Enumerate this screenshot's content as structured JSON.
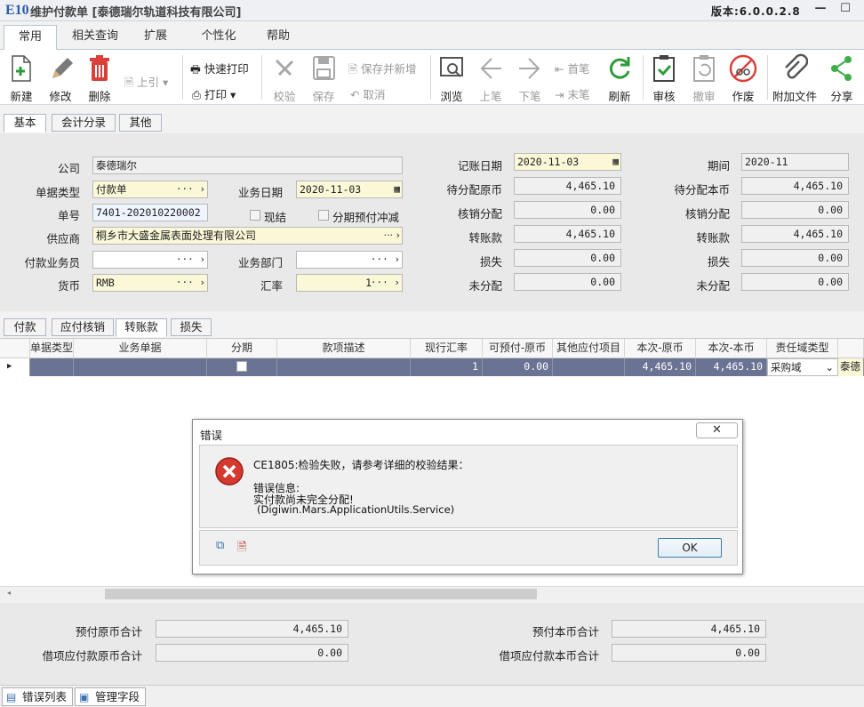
{
  "app": {
    "logo": "E10",
    "title": "维护付款单",
    "company": "[泰德瑞尔轨道科技有限公司]",
    "version": "版本:6.0.0.2.8",
    "minimize_glyph": "—",
    "maximize_glyph": "☐"
  },
  "menu_tabs": [
    "常用",
    "相关查询",
    "扩展",
    "个性化",
    "帮助"
  ],
  "toolbar": {
    "new": "新建",
    "edit": "修改",
    "delete": "删除",
    "upref": "上引",
    "quick_print": "快速打印",
    "print": "打印",
    "check": "校验",
    "save": "保存",
    "save_new": "保存并新增",
    "cancel": "取消",
    "browse": "浏览",
    "prev": "上笔",
    "next": "下笔",
    "first": "首笔",
    "last": "末笔",
    "refresh": "刷新",
    "approve": "审核",
    "unapprove": "撤审",
    "void": "作废",
    "attach": "附加文件",
    "share": "分享"
  },
  "main_tabs": [
    "基本",
    "会计分录",
    "其他"
  ],
  "form": {
    "company_label": "公司",
    "company_value": "泰德瑞尔",
    "doc_type_label": "单据类型",
    "doc_type_value": "付款单",
    "biz_date_label": "业务日期",
    "biz_date_value": "2020-11-03",
    "doc_no_label": "单号",
    "doc_no_value": "7401-202010220002",
    "cash_label": "现结",
    "installment_offset_label": "分期预付冲减",
    "supplier_label": "供应商",
    "supplier_value": "桐乡市大盛金属表面处理有限公司",
    "payer_label": "付款业务员",
    "dept_label": "业务部门",
    "currency_label": "货币",
    "currency_value": "RMB",
    "rate_label": "汇率",
    "rate_value": "1",
    "posting_date_label": "记账日期",
    "posting_date_value": "2020-11-03",
    "period_label": "期间",
    "period_value": "2020-11",
    "pending_orig_label": "待分配原币",
    "pending_orig_value": "4,465.10",
    "pending_local_label": "待分配本币",
    "pending_local_value": "4,465.10",
    "writeoff_label": "核销分配",
    "writeoff_orig_value": "0.00",
    "writeoff_local_value": "0.00",
    "transfer_label": "转账款",
    "transfer_orig_value": "4,465.10",
    "transfer_local_value": "4,465.10",
    "loss_label": "损失",
    "loss_orig_value": "0.00",
    "loss_local_value": "0.00",
    "unalloc_label": "未分配",
    "unalloc_orig_value": "0.00",
    "unalloc_local_value": "0.00",
    "ellipsis": "···"
  },
  "detail_tabs": [
    "付款",
    "应付核销",
    "转账款",
    "损失"
  ],
  "grid": {
    "columns": [
      "单据类型",
      "业务单据",
      "分期",
      "款项描述",
      "现行汇率",
      "可预付-原币",
      "其他应付项目",
      "本次-原币",
      "本次-本币",
      "责任域类型"
    ],
    "row": {
      "rate": "1",
      "prepay_orig": "0.00",
      "this_orig": "4,465.10",
      "this_local": "4,465.10",
      "domain_type": "采购域",
      "extra": "泰德"
    }
  },
  "dialog": {
    "title": "错误",
    "close_glyph": "✕",
    "line1": "CE1805:检验失败，请参考详细的校验结果：",
    "line2": "错误信息:",
    "line3": "实付款尚未完全分配!",
    "line4": "(Digiwin.Mars.ApplicationUtils.Service)",
    "ok": "OK"
  },
  "summary": {
    "prepay_orig_total_label": "预付原币合计",
    "prepay_orig_total_value": "4,465.10",
    "debit_orig_total_label": "借项应付款原币合计",
    "debit_orig_total_value": "0.00",
    "prepay_local_total_label": "预付本币合计",
    "prepay_local_total_value": "4,465.10",
    "debit_local_total_label": "借项应付款本币合计",
    "debit_local_total_value": "0.00"
  },
  "status_tabs": [
    "错误列表",
    "管理字段"
  ]
}
